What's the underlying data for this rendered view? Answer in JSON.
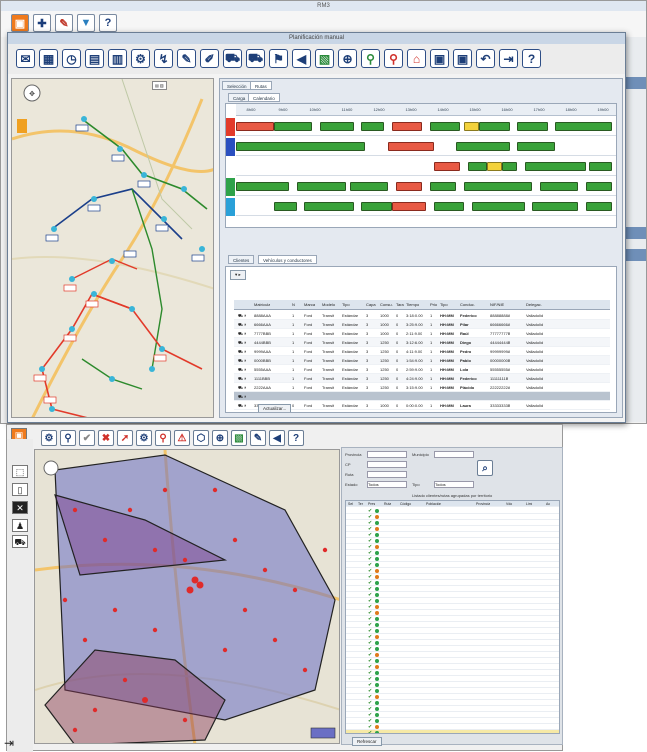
{
  "app": {
    "title": "RM3"
  },
  "main_toolbar": {
    "icons": [
      "app-logo-icon",
      "new-icon",
      "edit-icon",
      "filter-icon",
      "help-icon"
    ],
    "help_label": "?"
  },
  "planning": {
    "title": "Planificación manual",
    "toolbar_help": "?",
    "tabs": [
      "Selección",
      "Rutas"
    ],
    "subtabs": [
      "Carga",
      "Calendario"
    ],
    "hours": [
      "8h00",
      "9h00",
      "10h00",
      "11h00",
      "12h00",
      "13h00",
      "14h00",
      "15h00",
      "16h00",
      "17h00",
      "18h00",
      "19h00"
    ],
    "rows": [
      {
        "color": "#e23a2a",
        "segments": [
          {
            "s": 0,
            "e": 0.1,
            "c": "red"
          },
          {
            "s": 0.1,
            "e": 0.2,
            "c": "green"
          },
          {
            "s": 0.22,
            "e": 0.31,
            "c": "green"
          },
          {
            "s": 0.33,
            "e": 0.39,
            "c": "green"
          },
          {
            "s": 0.41,
            "e": 0.49,
            "c": "red"
          },
          {
            "s": 0.51,
            "e": 0.59,
            "c": "green"
          },
          {
            "s": 0.6,
            "e": 0.64,
            "c": "yellow"
          },
          {
            "s": 0.64,
            "e": 0.72,
            "c": "green"
          },
          {
            "s": 0.74,
            "e": 0.82,
            "c": "green"
          },
          {
            "s": 0.84,
            "e": 0.99,
            "c": "green"
          }
        ]
      },
      {
        "color": "#2a4fc0",
        "segments": [
          {
            "s": 0,
            "e": 0.34,
            "c": "green"
          },
          {
            "s": 0.4,
            "e": 0.52,
            "c": "red"
          },
          {
            "s": 0.58,
            "e": 0.72,
            "c": "green"
          },
          {
            "s": 0.74,
            "e": 0.84,
            "c": "green"
          }
        ]
      },
      {
        "color": "#ffffff",
        "segments": [
          {
            "s": 0.52,
            "e": 0.59,
            "c": "red"
          },
          {
            "s": 0.61,
            "e": 0.66,
            "c": "green"
          },
          {
            "s": 0.66,
            "e": 0.7,
            "c": "yellow"
          },
          {
            "s": 0.7,
            "e": 0.74,
            "c": "green"
          },
          {
            "s": 0.76,
            "e": 0.92,
            "c": "green"
          },
          {
            "s": 0.93,
            "e": 0.99,
            "c": "green"
          }
        ]
      },
      {
        "color": "#2ea24a",
        "segments": [
          {
            "s": 0,
            "e": 0.14,
            "c": "green"
          },
          {
            "s": 0.16,
            "e": 0.29,
            "c": "green"
          },
          {
            "s": 0.3,
            "e": 0.4,
            "c": "green"
          },
          {
            "s": 0.42,
            "e": 0.49,
            "c": "red"
          },
          {
            "s": 0.51,
            "e": 0.58,
            "c": "green"
          },
          {
            "s": 0.6,
            "e": 0.78,
            "c": "green"
          },
          {
            "s": 0.8,
            "e": 0.9,
            "c": "green"
          },
          {
            "s": 0.92,
            "e": 0.99,
            "c": "green"
          }
        ]
      },
      {
        "color": "#2aa0d8",
        "segments": [
          {
            "s": 0.1,
            "e": 0.16,
            "c": "green"
          },
          {
            "s": 0.18,
            "e": 0.31,
            "c": "green"
          },
          {
            "s": 0.33,
            "e": 0.41,
            "c": "green"
          },
          {
            "s": 0.41,
            "e": 0.5,
            "c": "red"
          },
          {
            "s": 0.52,
            "e": 0.6,
            "c": "green"
          },
          {
            "s": 0.62,
            "e": 0.76,
            "c": "green"
          },
          {
            "s": 0.78,
            "e": 0.9,
            "c": "green"
          },
          {
            "s": 0.92,
            "e": 0.99,
            "c": "green"
          }
        ]
      }
    ],
    "bottom_tabs": [
      "Clientes",
      "Vehículos y conductores"
    ],
    "columns": [
      "Matrícula",
      "N",
      "Marca",
      "Modelo",
      "Tipo",
      "Capa",
      "Consu.",
      "Tara",
      "Tiempo",
      "Prio",
      "Tipo",
      "Conduc.",
      "NIF/NIE",
      "Delegac."
    ],
    "vehicles": [
      [
        "8888AAA",
        "1",
        "Ford",
        "Transit",
        "Estándar",
        "3",
        "1000",
        "0",
        "3:18:0.00",
        "1",
        "HH:MM",
        "Federico",
        "88888888A",
        "Valladolid"
      ],
      [
        "6666AAA",
        "1",
        "Ford",
        "Transit",
        "Estándar",
        "3",
        "1000",
        "0",
        "3:25:9.00",
        "1",
        "HH:MM",
        "Pilar",
        "66666666A",
        "Valladolid"
      ],
      [
        "7777BBB",
        "1",
        "Ford",
        "Transit",
        "Estándar",
        "3",
        "1000",
        "0",
        "2:11:9.00",
        "1",
        "HH:MM",
        "Raúl",
        "77777777B",
        "Valladolid"
      ],
      [
        "4444BBB",
        "1",
        "Ford",
        "Transit",
        "Estándar",
        "3",
        "1250",
        "0",
        "3:12:6.00",
        "1",
        "HH:MM",
        "Diego",
        "44444444B",
        "Valladolid"
      ],
      [
        "9999AAA",
        "1",
        "Ford",
        "Transit",
        "Estándar",
        "3",
        "1250",
        "0",
        "4:11:9.00",
        "1",
        "HH:MM",
        "Pedro",
        "99999999A",
        "Valladolid"
      ],
      [
        "0000BBB",
        "1",
        "Ford",
        "Transit",
        "Estándar",
        "3",
        "1250",
        "0",
        "1:54:9.00",
        "1",
        "HH:MM",
        "Pablo",
        "00000000B",
        "Valladolid"
      ],
      [
        "5555AAA",
        "1",
        "Ford",
        "Transit",
        "Estándar",
        "3",
        "1250",
        "0",
        "2:59:9.00",
        "1",
        "HH:MM",
        "Lola",
        "55555555A",
        "Valladolid"
      ],
      [
        "1111BBB",
        "1",
        "Ford",
        "Transit",
        "Estándar",
        "3",
        "1250",
        "0",
        "4:24:9.00",
        "1",
        "HH:MM",
        "Federico",
        "11111111B",
        "Valladolid"
      ],
      [
        "2222AAA",
        "1",
        "Ford",
        "Transit",
        "Estándar",
        "3",
        "1250",
        "0",
        "3:15:9.00",
        "1",
        "HH:MM",
        "Plácido",
        "22222222A",
        "Valladolid"
      ],
      [
        "",
        "",
        "",
        "",
        "",
        "",
        "",
        "",
        "",
        "",
        "",
        "",
        "",
        ""
      ],
      [
        "3333BBB",
        "0",
        "Ford",
        "Transit",
        "Estándar",
        "3",
        "1000",
        "0",
        "0:00:0.00",
        "1",
        "HH:MM",
        "Laura",
        "33333333B",
        "Valladolid"
      ]
    ],
    "refresh_label": "Actualizar..."
  },
  "territory": {
    "search_labels": [
      "Provincia",
      "Municipio",
      "CP",
      "Ruta",
      "Estado",
      "Tipo"
    ],
    "select_value": "Todos",
    "table_title": "Listado clientes/rutas agrupadas por territorio",
    "columns": [
      "Sel",
      "Ter",
      "Pres",
      "Ruta",
      "Código",
      "Población",
      "Provincia",
      "Vdo",
      "Limi",
      "Ac"
    ],
    "row_count": 38,
    "refresh_label": "Refrescar"
  }
}
